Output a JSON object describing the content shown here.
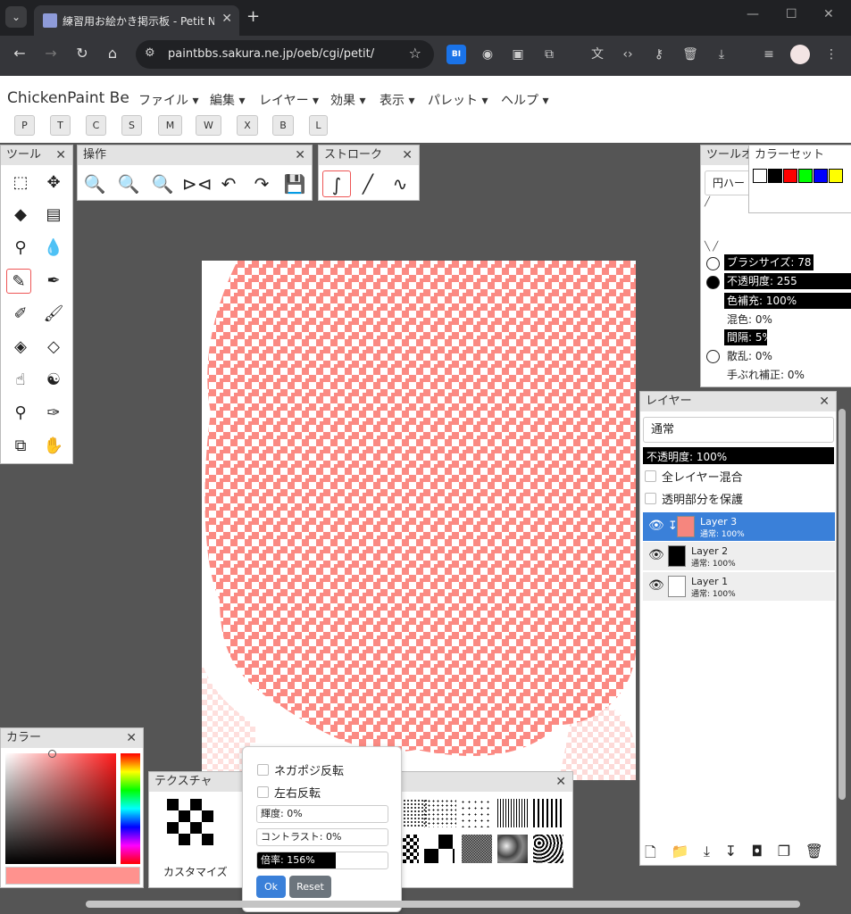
{
  "browser": {
    "tab_title": "練習用お絵かき掲示板 - Petit No",
    "url": "paintbbs.sakura.ne.jp/oeb/cgi/petit/",
    "tab_menu_icon": "chevron-down",
    "new_tab": "+",
    "window_min": "—",
    "window_max": "☐",
    "window_close": "✕"
  },
  "app": {
    "title": "ChickenPaint Be",
    "menus": [
      "ファイル ▾",
      "編集 ▾",
      "レイヤー ▾",
      "効果 ▾",
      "表示 ▾",
      "パレット ▾",
      "ヘルプ ▾"
    ],
    "mode_buttons": [
      "P",
      "T",
      "C",
      "S",
      "M",
      "W",
      "X",
      "B",
      "L"
    ]
  },
  "tools_palette": {
    "title": "ツール"
  },
  "ops_palette": {
    "title": "操作"
  },
  "stroke_palette": {
    "title": "ストローク"
  },
  "tool_options": {
    "title": "ツールオ",
    "tip_select": "円ハー",
    "brush_size": "ブラシサイズ: 78",
    "opacity": "不透明度: 255",
    "color_fill": "色補充: 100%",
    "blend": "混色: 0%",
    "spacing": "間隔: 5%",
    "scatter": "散乱: 0%",
    "smoothing": "手ぶれ補正: 0%"
  },
  "color_set": {
    "title": "カラーセット",
    "swatches": [
      "#ffffff",
      "#000000",
      "#ff0000",
      "#00ff00",
      "#0000ff",
      "#ffff00"
    ]
  },
  "layers_palette": {
    "title": "レイヤー",
    "blend_mode": "通常",
    "opacity": "不透明度: 100%",
    "opacity_fraction": 1.0,
    "merge_all": "全レイヤー混合",
    "protect_alpha": "透明部分を保護",
    "layers": [
      {
        "name": "Layer 3",
        "mode": "通常: 100%",
        "selected": true,
        "thumb_color": "#f6867e"
      },
      {
        "name": "Layer 2",
        "mode": "通常: 100%",
        "selected": false,
        "thumb_color": "#000000"
      },
      {
        "name": "Layer 1",
        "mode": "通常: 100%",
        "selected": false,
        "thumb_color": "#ffffff"
      }
    ]
  },
  "color_palette": {
    "title": "カラー",
    "current_color": "#ff928e"
  },
  "texture_palette": {
    "title": "テクスチャ",
    "customize": "カスタマイズ",
    "invert": "ネガポジ反転",
    "mirror": "左右反転",
    "brightness": "輝度: 0%",
    "contrast": "コントラスト: 0%",
    "scale": "倍率: 156%",
    "scale_fraction": 0.6,
    "ok": "Ok",
    "reset": "Reset"
  },
  "colors": {
    "accent_blue": "#3a80d9",
    "paint_salmon": "#fb8a83",
    "selected_tool_border": "#e55555"
  }
}
